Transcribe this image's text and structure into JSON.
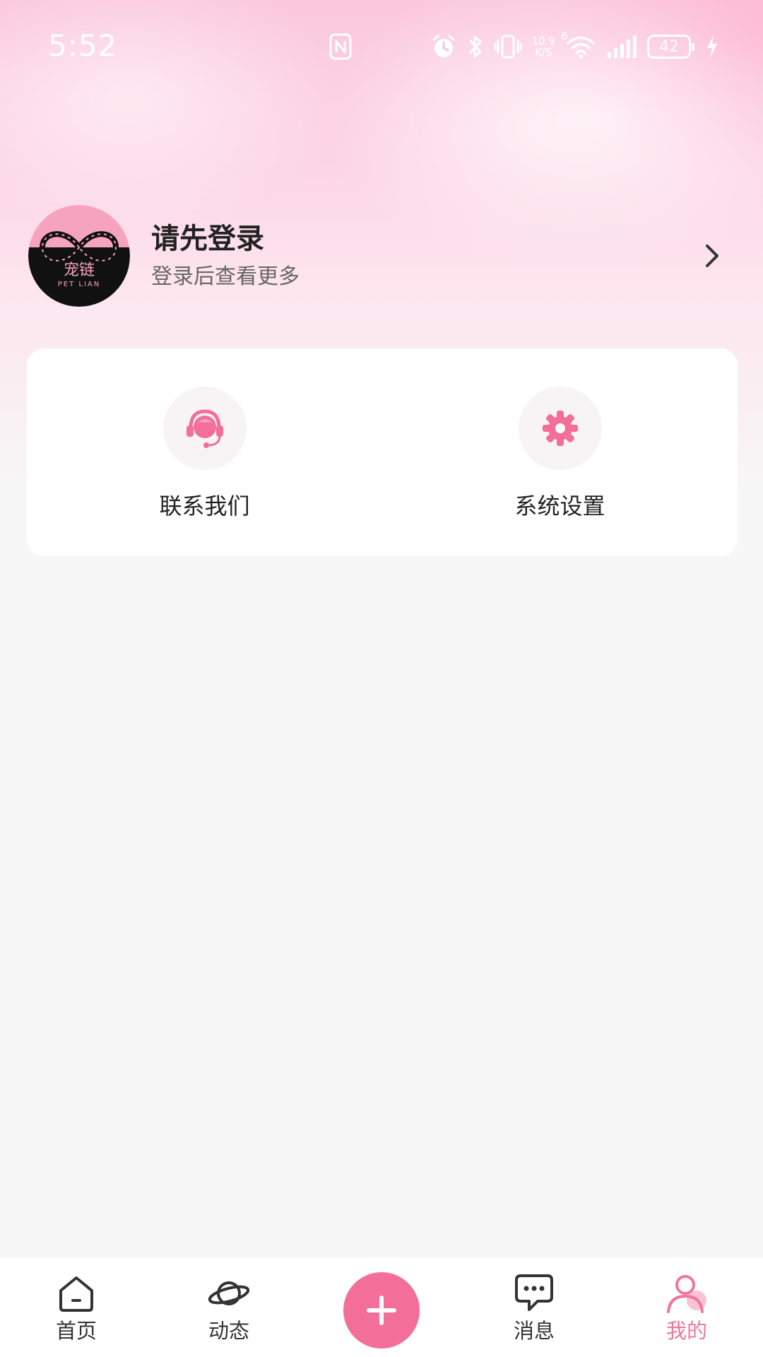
{
  "status_bar": {
    "time": "5:52",
    "net_speed_value": "10.9",
    "net_speed_unit": "K/S",
    "wifi_badge": "6",
    "battery": "42",
    "icons": [
      "nfc-icon",
      "alarm-icon",
      "bluetooth-icon",
      "vibrate-icon",
      "wifi-icon",
      "signal-icon",
      "battery-icon",
      "charging-icon"
    ]
  },
  "profile": {
    "title": "请先登录",
    "subtitle": "登录后查看更多",
    "avatar_text": "宠链",
    "avatar_subtext": "PET LIAN"
  },
  "quick_actions": [
    {
      "label": "联系我们",
      "icon": "customer-service-icon"
    },
    {
      "label": "系统设置",
      "icon": "gear-icon"
    }
  ],
  "bottom_nav": {
    "items": [
      {
        "label": "首页",
        "icon": "home-icon"
      },
      {
        "label": "动态",
        "icon": "planet-icon"
      },
      {
        "label": "消息",
        "icon": "chat-icon"
      },
      {
        "label": "我的",
        "icon": "user-icon",
        "active": true
      }
    ],
    "center_icon": "plus-icon"
  },
  "colors": {
    "accent": "#f36e98",
    "active_tab": "#f0769c",
    "background": "#f7f7f8",
    "hero_pink": "#fbc8dc"
  }
}
